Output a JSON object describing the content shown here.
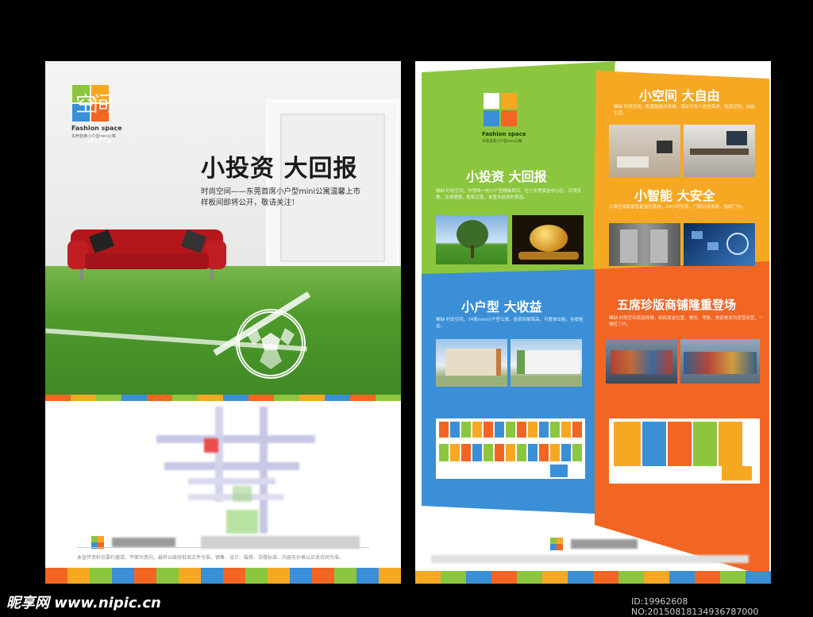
{
  "left_flyer": {
    "brand_mark": "空间时尚",
    "brand_en": "Fashion space",
    "brand_tag": "东莞首席小户型mini公寓",
    "headline": "小投资  大回报",
    "sub_line1": "时尚空间——东莞首席小户型mini公寓温馨上市",
    "sub_line2": "样板间即将公开，敬请关注！",
    "footer_fine": "本宣传资料仅要约邀请，平面为意向，最终以政府批准文件为准。销售、设计、装修、交楼标准、内容及价格以买卖合同为准。"
  },
  "right_flyer": {
    "brand_en": "Fashion space",
    "brand_tag": "东莞首席小户型mini公寓",
    "sec1_title": "小投资  大回报",
    "sec1_text": "稀缺·时尚空间，东莞唯一的小户型精装项目，位于东莞黄金中心区。环境优美，交通便捷，配套完善，是置业投资的首选。",
    "sec2_title": "小空间  大自由",
    "sec2_text": "稀缺·时尚空间，配置智能化系统，满足年轻人居住需求，独享空间，自由生活。",
    "sec3_title": "小智能  大安全",
    "sec3_text": "公寓全面配备智能监控系统，24小时安保，门禁对讲系统，指纹门卡。",
    "sec4_title": "小户型  大收益",
    "sec4_text": "稀缺·时尚空间，74套mini小户型公寓，投资回报率高，可整体出租，坐收租金。",
    "sec5_title": "五席珍版商铺隆重登场",
    "sec5_text": "稀缺·时尚空间首层商铺，临街黄金位置，餐饮、零售、美容美发均适宜经营，一铺旺三代。"
  },
  "colors": {
    "green": "#8cc63f",
    "blue": "#3a8fd6",
    "orange": "#f7a823",
    "red_orange": "#f26522",
    "sofa_red": "#b3171b",
    "turf": "#4e9a2c"
  },
  "icons": [
    "soccer-ball-icon",
    "color-blocks-logo-icon",
    "floor-plan-icon",
    "map-icon"
  ],
  "watermark": {
    "site": "昵享网 www.nipic.cn",
    "id": "ID:19962608 NO:20150818134936787000"
  }
}
